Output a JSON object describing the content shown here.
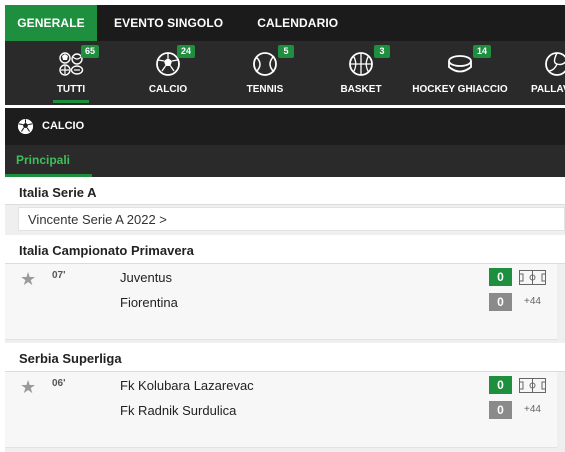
{
  "topnav": {
    "tabs": [
      {
        "label": "GENERALE"
      },
      {
        "label": "EVENTO SINGOLO"
      },
      {
        "label": "CALENDARIO"
      }
    ]
  },
  "sports": [
    {
      "label": "TUTTI",
      "count": "65",
      "icon": "multi-sport-icon"
    },
    {
      "label": "CALCIO",
      "count": "24",
      "icon": "soccer-ball-icon"
    },
    {
      "label": "TENNIS",
      "count": "5",
      "icon": "tennis-ball-icon"
    },
    {
      "label": "BASKET",
      "count": "3",
      "icon": "basketball-icon"
    },
    {
      "label": "HOCKEY GHIACCIO",
      "count": "14",
      "icon": "hockey-puck-icon"
    },
    {
      "label": "PALLAV",
      "icon": "volleyball-icon"
    }
  ],
  "section": {
    "title": "CALCIO"
  },
  "subtabs": {
    "principali": "Principali"
  },
  "leagues": [
    {
      "name": "Italia Serie A",
      "link": "Vincente Serie A 2022 >"
    },
    {
      "name": "Italia Campionato Primavera"
    },
    {
      "name": "Serbia Superliga"
    }
  ],
  "matches": [
    {
      "time": "07'",
      "home": "Juventus",
      "away": "Fiorentina",
      "home_score": "0",
      "away_score": "0",
      "more": "+44"
    },
    {
      "time": "06'",
      "home": "Fk Kolubara Lazarevac",
      "away": "Fk Radnik Surdulica",
      "home_score": "0",
      "away_score": "0",
      "more": "+44"
    }
  ],
  "colors": {
    "accent": "#1e8f3e",
    "dark": "#1b1b1b",
    "bar": "#2a2a2a"
  }
}
